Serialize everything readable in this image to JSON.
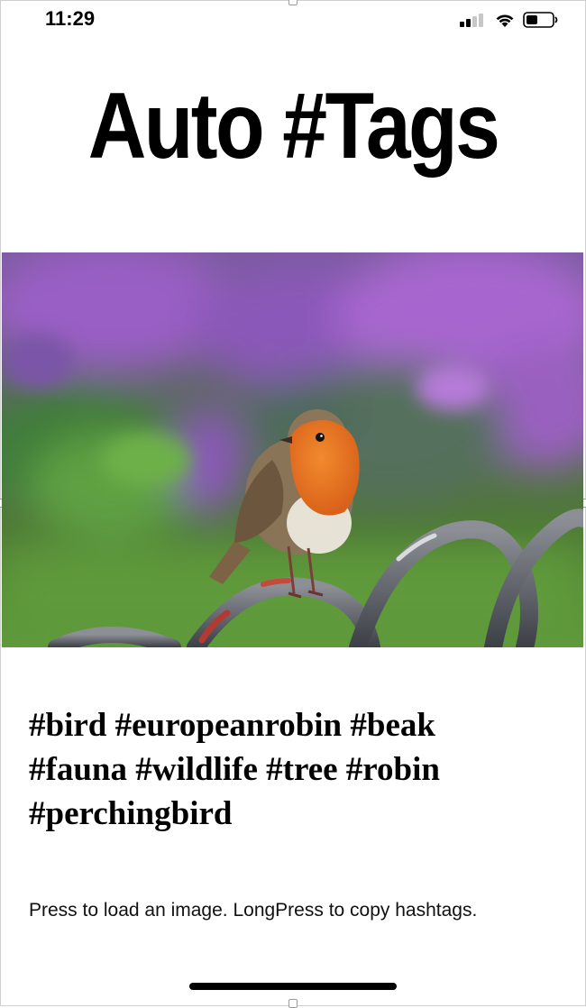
{
  "status_bar": {
    "time": "11:29",
    "icons": [
      "cellular-signal-icon",
      "wifi-icon",
      "battery-icon"
    ]
  },
  "app": {
    "title": "Auto #Tags"
  },
  "photo": {
    "subject": "robin perched on a metal railing"
  },
  "hashtags": {
    "lines": [
      "#bird #europeanrobin #beak",
      "#fauna #wildlife #tree #robin",
      "#perchingbird"
    ]
  },
  "hint": {
    "text": "Press to load an image. LongPress to copy hashtags."
  },
  "colors": {
    "background": "#ffffff",
    "text": "#000000",
    "robin_breast": "#e8741f",
    "flowers": "#9a5fc4",
    "grass": "#5f9a3c"
  }
}
